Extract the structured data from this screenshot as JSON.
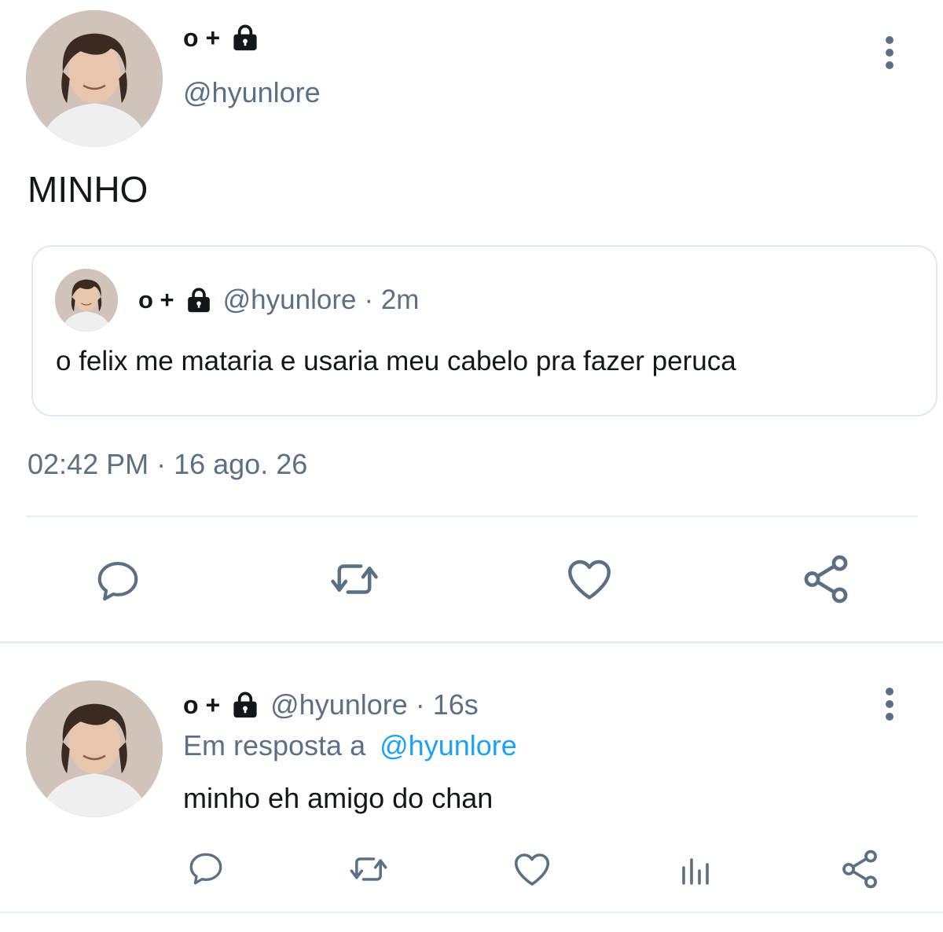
{
  "main_tweet": {
    "display_name": "o +",
    "handle": "@hyunlore",
    "text": "MINHO",
    "timestamp": "02:42 PM · 16 ago. 26",
    "quoted_tweet": {
      "display_name": "o +",
      "handle": "@hyunlore",
      "age": "· 2m",
      "text": "o felix me mataria e usaria meu cabelo pra fazer peruca"
    },
    "actions": [
      "reply-icon",
      "retweet-icon",
      "like-icon",
      "share-icon"
    ]
  },
  "reply_tweet": {
    "display_name": "o +",
    "handle": "@hyunlore",
    "age": "· 16s",
    "reply_prefix": "Em resposta a",
    "reply_to": "@hyunlore",
    "text": "minho eh amigo do chan",
    "actions": [
      "reply-icon",
      "retweet-icon",
      "like-icon",
      "analytics-icon",
      "share-icon"
    ]
  },
  "colors": {
    "text": "#14171a",
    "secondary": "#5b7083",
    "link": "#1da1f2",
    "divider": "#e6ecf0",
    "icon": "#5b7083"
  }
}
